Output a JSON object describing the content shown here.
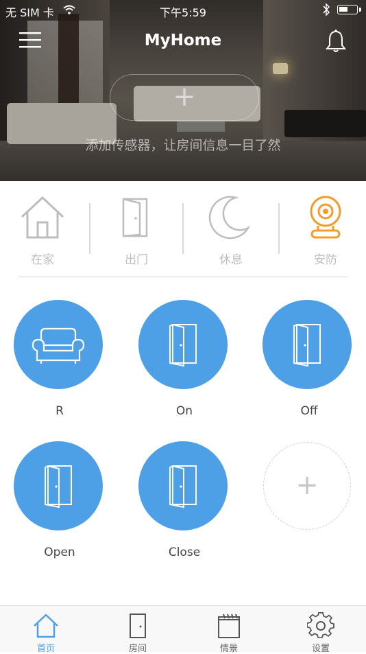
{
  "status_bar": {
    "carrier": "无 SIM 卡",
    "time": "下午5:59",
    "battery_level": 0.5
  },
  "nav": {
    "title": "MyHome",
    "menu_icon": "hamburger-icon",
    "bell_icon": "bell-icon"
  },
  "hero": {
    "add_hint": "添加传感器，让房间信息一目了然",
    "plus": "+"
  },
  "modes": [
    {
      "label": "在家",
      "icon": "home-icon",
      "active": false
    },
    {
      "label": "出门",
      "icon": "door-icon",
      "active": false
    },
    {
      "label": "休息",
      "icon": "moon-icon",
      "active": false
    },
    {
      "label": "安防",
      "icon": "camera-icon",
      "active": true
    }
  ],
  "devices": [
    {
      "label": "R",
      "icon": "sofa-icon"
    },
    {
      "label": "On",
      "icon": "door-icon"
    },
    {
      "label": "Off",
      "icon": "door-icon"
    },
    {
      "label": "Open",
      "icon": "door-icon"
    },
    {
      "label": "Close",
      "icon": "door-icon"
    }
  ],
  "add_device": {
    "plus": "+"
  },
  "tabs": [
    {
      "label": "首页",
      "icon": "home-icon",
      "active": true
    },
    {
      "label": "房间",
      "icon": "door-icon",
      "active": false
    },
    {
      "label": "情景",
      "icon": "clapperboard-icon",
      "active": false
    },
    {
      "label": "设置",
      "icon": "gear-icon",
      "active": false
    }
  ],
  "colors": {
    "accent_blue": "#4d9fe6",
    "active_orange": "#f39c2c",
    "inactive_gray": "#bdbdbd"
  }
}
